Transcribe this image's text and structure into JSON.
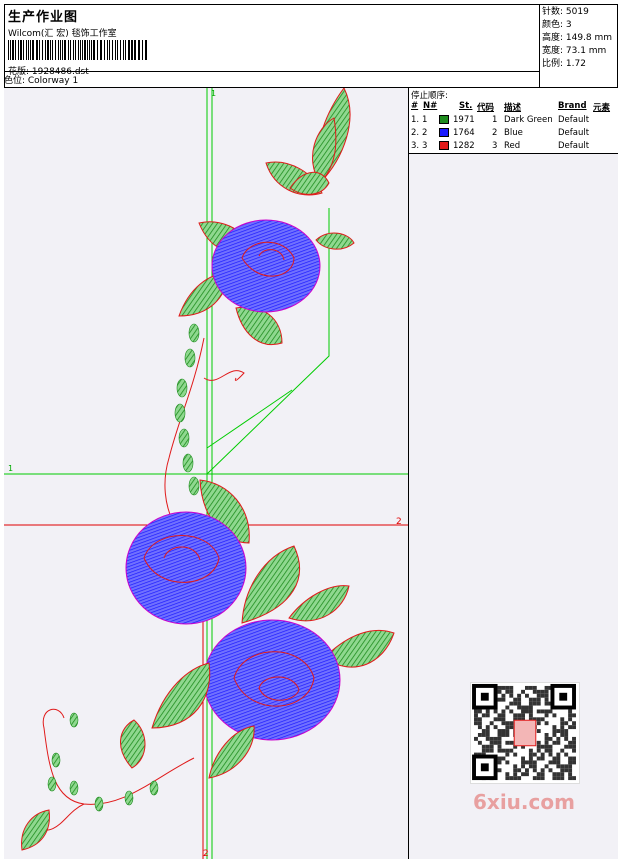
{
  "header": {
    "title": "生产作业图",
    "company": "Wilcom(汇 宏) 毯饰工作室",
    "design": "花版: 1928486.dst",
    "colorway": "色位: Colorway 1"
  },
  "stats": {
    "stitches": "针数: 5019",
    "colors": "颜色: 3",
    "height": "高度: 149.8 mm",
    "width": "宽度: 73.1 mm",
    "scale": "比例: 1.72"
  },
  "stop_sequence": {
    "title": "停止顺序:",
    "headers": [
      "#",
      "N#",
      "St.",
      "代码",
      "描述",
      "Brand",
      "元素"
    ],
    "rows": [
      {
        "index": "1.",
        "needle": "1",
        "stitches": "1971",
        "code": "1",
        "description": "Dark Green",
        "brand": "Default",
        "color": "#1e8c1e"
      },
      {
        "index": "2.",
        "needle": "2",
        "stitches": "1764",
        "code": "2",
        "description": "Blue",
        "brand": "Default",
        "color": "#1a1aff"
      },
      {
        "index": "3.",
        "needle": "3",
        "stitches": "1282",
        "code": "3",
        "description": "Red",
        "brand": "Default",
        "color": "#e01a1a"
      }
    ]
  },
  "guides": {
    "top_label": "1",
    "left_label": "1",
    "right_label": "2",
    "bottom_label": "2"
  },
  "watermark": "6xiu.com",
  "colors": {
    "green": "#1e8c1e",
    "blue": "#1a1aff",
    "red": "#e01a1a",
    "guide_green": "#00cc00",
    "guide_red": "#e00000"
  }
}
